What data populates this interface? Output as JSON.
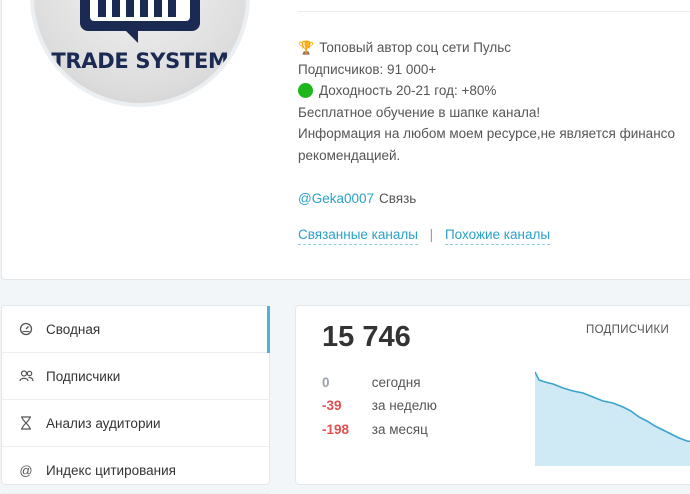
{
  "channel": {
    "logo_text": "TRADE SYSTEM",
    "description": [
      "Топовый автор соц сети Пульс",
      "Подписчиков: 91 000+",
      "Доходность 20-21 год: +80%",
      "Бесплатное обучение в шапке канала!",
      "Информация на любом моем ресурсе,не является финансо",
      "рекомендацией."
    ],
    "contact_handle": "@Geka0007",
    "contact_label": "Связь",
    "icons": [
      "trophy-icon",
      "green-circle-icon"
    ]
  },
  "links": {
    "related": "Связанные каналы",
    "separator": "|",
    "similar": "Похожие каналы"
  },
  "menu": {
    "items": [
      {
        "label": "Сводная",
        "icon": "dashboard-icon",
        "active": true
      },
      {
        "label": "Подписчики",
        "icon": "users-icon",
        "active": false
      },
      {
        "label": "Анализ аудитории",
        "icon": "hourglass-icon",
        "active": false
      },
      {
        "label": "Индекс цитирования",
        "icon": "at-icon",
        "active": false
      }
    ]
  },
  "stats": {
    "subscribers": "15 746",
    "label": "ПОДПИСЧИКИ",
    "rows": [
      {
        "value": "0",
        "label": "сегодня"
      },
      {
        "value": "-39",
        "label": "за неделю"
      },
      {
        "value": "-198",
        "label": "за месяц"
      }
    ],
    "accent_color": "#3aa3cf",
    "negative_color": "#e05050"
  }
}
